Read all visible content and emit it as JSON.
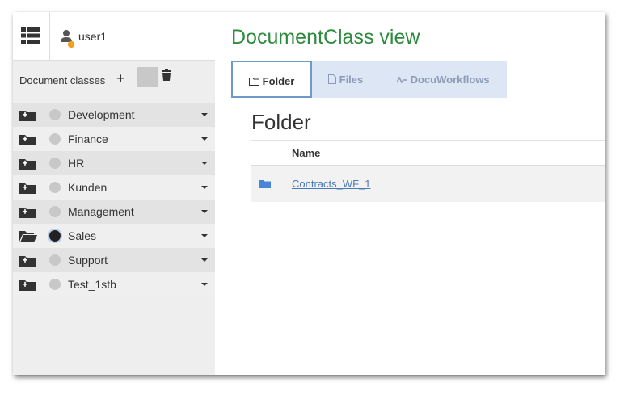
{
  "header": {
    "user_name": "user1"
  },
  "sidebar": {
    "document_classes_label": "Document classes",
    "add_symbol": "+",
    "items": [
      {
        "label": "Development",
        "selected": false,
        "open": false
      },
      {
        "label": "Finance",
        "selected": false,
        "open": false
      },
      {
        "label": "HR",
        "selected": false,
        "open": false
      },
      {
        "label": "Kunden",
        "selected": false,
        "open": false
      },
      {
        "label": "Management",
        "selected": false,
        "open": false
      },
      {
        "label": "Sales",
        "selected": true,
        "open": true
      },
      {
        "label": "Support",
        "selected": false,
        "open": false
      },
      {
        "label": "Test_1stb",
        "selected": false,
        "open": false
      }
    ]
  },
  "main": {
    "title": "DocumentClass view",
    "tabs": [
      {
        "label": "Folder",
        "icon": "folder-outline-icon",
        "active": true
      },
      {
        "label": "Files",
        "icon": "file-icon",
        "active": false
      },
      {
        "label": "DocuWorkflows",
        "icon": "workflow-icon",
        "active": false
      }
    ],
    "section_title": "Folder",
    "table": {
      "columns": [
        "Name"
      ],
      "rows": [
        {
          "name": "Contracts_WF_1",
          "icon": "folder-icon"
        }
      ]
    }
  },
  "colors": {
    "title_green": "#2e8b3e",
    "tab_bg": "#dde6f4",
    "link_blue": "#4a7ab8",
    "status_dot": "#f0a020"
  }
}
